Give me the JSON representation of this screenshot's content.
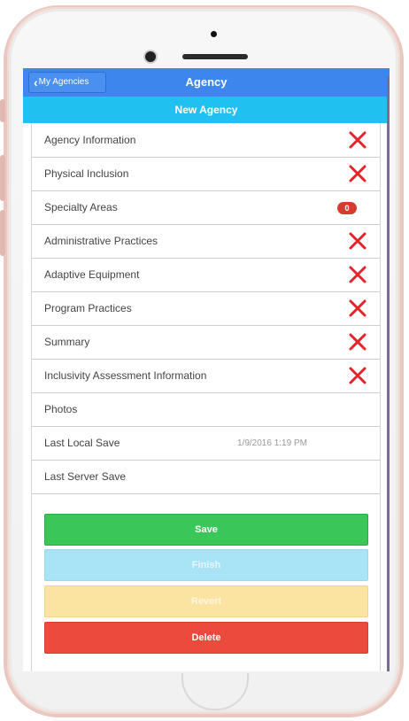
{
  "header": {
    "back_label": "My Agencies",
    "title": "Agency",
    "subtitle": "New Agency"
  },
  "sections": [
    {
      "label": "Agency Information",
      "status": "incomplete"
    },
    {
      "label": "Physical Inclusion",
      "status": "incomplete"
    },
    {
      "label": "Specialty Areas",
      "badge": "0"
    },
    {
      "label": "Administrative Practices",
      "status": "incomplete"
    },
    {
      "label": "Adaptive Equipment",
      "status": "incomplete"
    },
    {
      "label": "Program Practices",
      "status": "incomplete"
    },
    {
      "label": "Summary",
      "status": "incomplete"
    },
    {
      "label": "Inclusivity Assessment Information",
      "status": "incomplete"
    },
    {
      "label": "Photos"
    },
    {
      "label": "Last Local Save",
      "value": "1/9/2016 1:19 PM"
    },
    {
      "label": "Last Server Save",
      "value": ""
    }
  ],
  "actions": {
    "save": "Save",
    "finish": "Finish",
    "revert": "Revert",
    "delete": "Delete"
  },
  "colors": {
    "topbar": "#3d86ee",
    "subbar": "#20c1f0",
    "incomplete_icon": "#e3252b",
    "save": "#3ac757",
    "finish": "#a9e3f6",
    "revert": "#fbe3a2",
    "delete": "#ec4a3c"
  },
  "icons": {
    "back": "chevron-left-icon",
    "incomplete": "close-icon"
  }
}
